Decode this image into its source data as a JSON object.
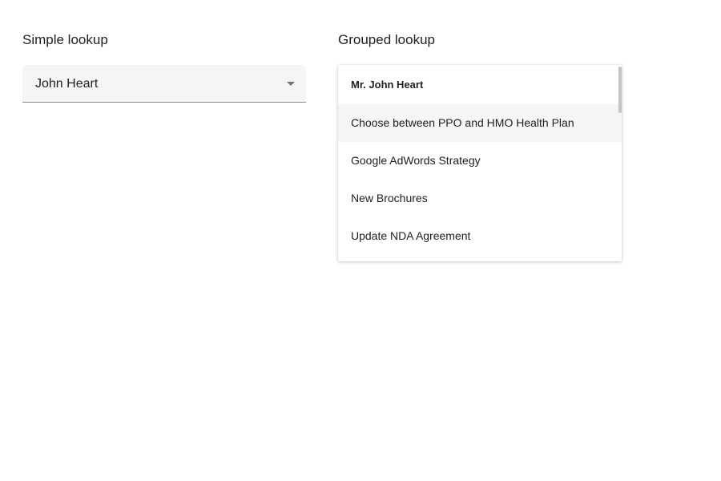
{
  "simple_lookup": {
    "title": "Simple lookup",
    "selected_value": "John Heart"
  },
  "grouped_lookup": {
    "title": "Grouped lookup",
    "group_header": "Mr. John Heart",
    "items": [
      {
        "label": "Choose between PPO and HMO Health Plan",
        "hovered": true
      },
      {
        "label": "Google AdWords Strategy",
        "hovered": false
      },
      {
        "label": "New Brochures",
        "hovered": false
      },
      {
        "label": "Update NDA Agreement",
        "hovered": false
      }
    ]
  },
  "icons": {
    "dropdown": "chevron-down-icon"
  },
  "colors": {
    "field_background": "#f5f5f5",
    "hover_background": "#f5f5f5",
    "text": "#212121"
  }
}
